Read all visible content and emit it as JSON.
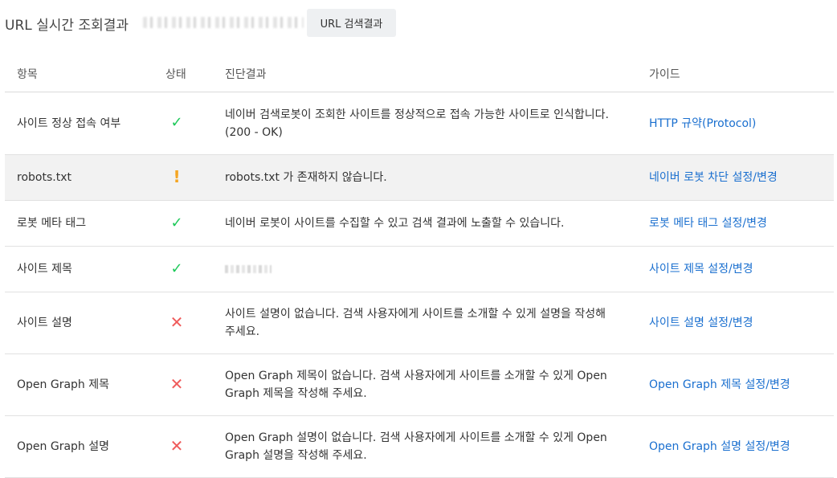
{
  "header": {
    "title": "URL 실시간 조회결과",
    "search_button": "URL 검색결과"
  },
  "table": {
    "columns": [
      "항목",
      "상태",
      "진단결과",
      "가이드"
    ],
    "rows": [
      {
        "item": "사이트 정상 접속 여부",
        "status": "ok",
        "status_icon": "✓",
        "result": "네이버 검색로봇이 조회한 사이트를 정상적으로 접속 가능한 사이트로 인식합니다.",
        "result2": "(200 - OK)",
        "guide": "HTTP 규약(Protocol)"
      },
      {
        "item": "robots.txt",
        "status": "warning",
        "status_icon": "!",
        "result": "robots.txt 가 존재하지 않습니다.",
        "result2": "",
        "guide": "네이버 로봇 차단 설정/변경"
      },
      {
        "item": "로봇 메타 태그",
        "status": "ok",
        "status_icon": "✓",
        "result": "네이버 로봇이 사이트를 수집할 수 있고 검색 결과에 노출할 수 있습니다.",
        "result2": "",
        "guide": "로봇 메타 태그 설정/변경"
      },
      {
        "item": "사이트 제목",
        "status": "ok",
        "status_icon": "✓",
        "result": "",
        "result2": "",
        "guide": "사이트 제목 설정/변경"
      },
      {
        "item": "사이트 설명",
        "status": "error",
        "status_icon": "✕",
        "result": "사이트 설명이 없습니다. 검색 사용자에게 사이트를 소개할 수 있게 설명을 작성해",
        "result2": "주세요.",
        "guide": "사이트 설명 설정/변경"
      },
      {
        "item": "Open Graph 제목",
        "status": "error",
        "status_icon": "✕",
        "result": "Open Graph 제목이 없습니다. 검색 사용자에게 사이트를 소개할 수 있게 Open",
        "result2": "Graph 제목을 작성해 주세요.",
        "guide": "Open Graph 제목 설정/변경"
      },
      {
        "item": "Open Graph 설명",
        "status": "error",
        "status_icon": "✕",
        "result": "Open Graph 설명이 없습니다. 검색 사용자에게 사이트를 소개할 수 있게 Open",
        "result2": "Graph 설명을 작성해 주세요.",
        "guide": "Open Graph 설명 설정/변경"
      }
    ]
  },
  "colors": {
    "ok": "#1ec95a",
    "warning": "#f5a623",
    "error": "#ef5b5b",
    "link": "#1a6fcf",
    "highlight_row": "#f2f2f2"
  }
}
